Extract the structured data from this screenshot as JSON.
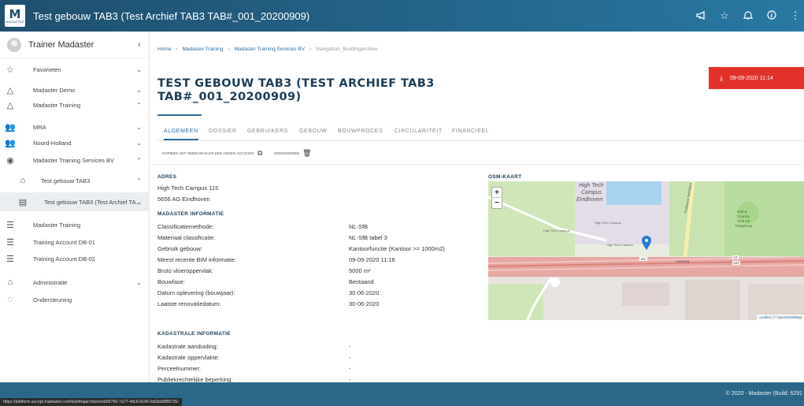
{
  "header": {
    "logo_letter": "M",
    "logo_word": "MADASTER",
    "title": "Test gebouw TAB3 (Test Archief TAB3 TAB#_001_20200909)",
    "icons": [
      "megaphone-icon",
      "star-icon",
      "bell-icon",
      "info-icon",
      "more-icon"
    ]
  },
  "sidebar": {
    "user": "Trainer Madaster",
    "items": [
      {
        "label": "Favorieten",
        "icon": "star-icon",
        "chevron": "down"
      },
      {
        "label": "Madaster Demo",
        "icon": "triangle-icon",
        "chevron": "down"
      },
      {
        "label": "Madaster Training",
        "icon": "triangle-icon",
        "chevron": "up"
      },
      {
        "label": "MRA",
        "icon": "group-icon",
        "chevron": "down"
      },
      {
        "label": "Noord-Holland",
        "icon": "group-icon",
        "chevron": "down"
      },
      {
        "label": "Madaster Training Services BV",
        "icon": "badge-icon",
        "chevron": "up"
      },
      {
        "label": "Test gebouw TAB3",
        "icon": "building-icon",
        "chevron": "up"
      },
      {
        "label": "Test gebouw TAB3 (Test Archief TA...",
        "icon": "archive-icon",
        "chevron": "down"
      },
      {
        "label": "Madaster Training",
        "icon": "database-icon",
        "chevron": ""
      },
      {
        "label": "Training Account DB-01",
        "icon": "database-icon",
        "chevron": ""
      },
      {
        "label": "Training Account DB-02",
        "icon": "database-icon",
        "chevron": ""
      },
      {
        "label": "Administratie",
        "icon": "home-icon",
        "chevron": "down"
      },
      {
        "label": "Ondersteuning",
        "icon": "lifebuoy-icon",
        "chevron": ""
      }
    ]
  },
  "breadcrumb": {
    "home": "Home",
    "level1": "Madaster Training",
    "level2": "Madaster Training Services BV",
    "current": "Navigation_Buildingarchive"
  },
  "page": {
    "title": "TEST GEBOUW TAB3 (TEST ARCHIEF TAB3 TAB#_001_20200909)",
    "date_button": "09-09-2020 11:14",
    "date_button_color": "#e2312b"
  },
  "tabs": [
    "ALGEMEEN",
    "DOSSIER",
    "GEBRUIKERS",
    "GEBOUW",
    "BOUWPROCES",
    "CIRCULARITEIT",
    "FINANCIEEL"
  ],
  "actions": {
    "copy_label": "KOPIEER HET GEBOUW NAAR EEN ANDER ACCOUNT.",
    "delete_label": "VERWIJDEREN"
  },
  "address": {
    "title": "ADRES",
    "line1": "High Tech Campus 115",
    "line2": "5656 AG Eindhoven"
  },
  "madaster_info": {
    "title": "MADASTER INFORMATIE",
    "rows": [
      {
        "label": "Classificatiemethode:",
        "value": "NL-SfB"
      },
      {
        "label": "Materiaal classificatie:",
        "value": "NL-SfB tabel 3"
      },
      {
        "label": "Gebruik gebouw:",
        "value": "Kantoorfunctie (Kantoor >= 1000m2)"
      },
      {
        "label": "Meest recente BIM informatie:",
        "value": "09-09-2020 11:16"
      },
      {
        "label": "Bruto vloeroppervlak:",
        "value": "5000 m²"
      },
      {
        "label": "Bouwfase:",
        "value": "Bestaand"
      },
      {
        "label": "Datum oplevering (bouwjaar):",
        "value": "30-06-2020"
      },
      {
        "label": "Laatste renovatiedatum:",
        "value": "30-06-2020"
      }
    ]
  },
  "kadastrale_info": {
    "title": "KADASTRALE INFORMATIE",
    "rows": [
      {
        "label": "Kadastrale aanduiding:",
        "value": "-"
      },
      {
        "label": "Kadastrale oppervlakte:",
        "value": "-"
      },
      {
        "label": "Perceelnummer:",
        "value": "-"
      },
      {
        "label": "Publiekrechtelijke beperking:",
        "value": "-"
      }
    ]
  },
  "map": {
    "title": "OSM-KAART",
    "zoom_in": "+",
    "zoom_out": "−",
    "labels": [
      "High Tech",
      "Campus",
      "Eindhoven",
      "High Tech Campus",
      "High Tech Campus",
      "High Tech Campus",
      "N2",
      "Laarweg",
      "A2",
      "A67",
      "Golf &",
      "Country",
      "Club De",
      "Tongelreep",
      "Professor Holstlaan"
    ],
    "attribution": "Leaflet | © OpenStreetMap"
  },
  "footer": {
    "copyright": "© 2020 - Madaster (Build: 6291",
    "status_url": "https://platform.accept.madaster.com/buildingarchive/ceb89790-7a77-4dc6-8156-0a58a9880735/"
  }
}
